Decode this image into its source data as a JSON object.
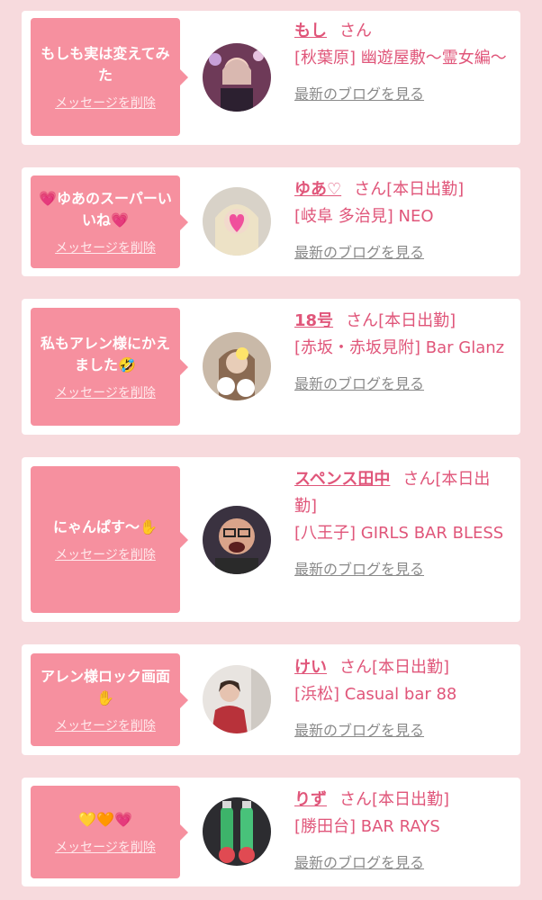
{
  "colors": {
    "page_bg": "#f7dadd",
    "bubble": "#f6909f",
    "accent": "#e0567a",
    "muted": "#8a8a8a"
  },
  "delete_label": "メッセージを削除",
  "blog_label": "最新のブログを見る",
  "san": "さん",
  "items": [
    {
      "message": "もしも実は変えてみた",
      "name": "もし",
      "status": "",
      "shop": "[秋葉原] 幽遊屋敷〜霊女編〜",
      "avatar": "photo-avatar-1"
    },
    {
      "message": "💗ゆあのスーパーいいね💗",
      "name": "ゆあ♡",
      "status": "[本日出勤]",
      "shop": "[岐阜 多治見] NEO",
      "avatar": "photo-avatar-2"
    },
    {
      "message": "私もアレン様にかえました🤣",
      "name": "18号",
      "status": "[本日出勤]",
      "shop": "[赤坂・赤坂見附] Bar Glanz",
      "avatar": "photo-avatar-3"
    },
    {
      "message": "にゃんぱす〜✋",
      "name": "スペンス田中",
      "status": "[本日出勤]",
      "shop": "[八王子] GIRLS BAR BLESS",
      "avatar": "photo-avatar-4"
    },
    {
      "message": "アレン様ロック画面✋",
      "name": "けい",
      "status": "[本日出勤]",
      "shop": "[浜松] Casual bar 88",
      "avatar": "photo-avatar-5"
    },
    {
      "message": "💛🧡💗",
      "name": "りず",
      "status": "[本日出勤]",
      "shop": "[勝田台] BAR RAYS",
      "avatar": "photo-avatar-6"
    }
  ]
}
